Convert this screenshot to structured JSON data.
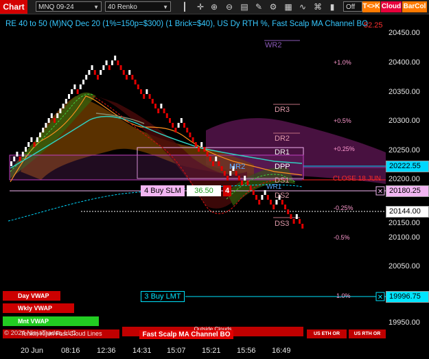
{
  "toolbar": {
    "title": "Chart",
    "instrument": "MNQ 09-24",
    "bar_type": "40 Renko",
    "toggle_value": "Off",
    "buttons": {
      "t_k": "T<>K",
      "cloud": "Cloud",
      "barcol": "BarCol"
    },
    "icons": [
      "bars-icon",
      "crosshair-icon",
      "zoom-in-icon",
      "zoom-out-icon",
      "data-box-icon",
      "pencil-icon",
      "chart-properties-icon",
      "templates-icon",
      "indicators-icon",
      "strategies-icon",
      "bar-style-icon",
      "camera-icon"
    ]
  },
  "chart_title": "RE 40 to 50 (M)NQ Dec 20 (1%=150p=$300) (1 Brick=$40), US Dy RTH %, Fast Scalp MA Channel BO",
  "overlay_partial": "52.25",
  "price_axis": {
    "ticks": [
      "20450.00",
      "20400.00",
      "20350.00",
      "20300.00",
      "20250.00",
      "20200.00",
      "20150.00",
      "20100.00",
      "20050.00",
      "19950.00"
    ],
    "boxes": [
      {
        "label": "20222.55",
        "color": "#00d8ff",
        "text": "#000000"
      },
      {
        "label": "20180.25",
        "color": "#f2b6f2",
        "text": "#000000"
      },
      {
        "label": "20144.00",
        "color": "#ffffff",
        "text": "#000000"
      },
      {
        "label": "19996.75",
        "color": "#00e5ff",
        "text": "#000000"
      }
    ]
  },
  "time_axis": [
    "20 Jun",
    "08:16",
    "12:36",
    "14:31",
    "15:07",
    "15:21",
    "15:56",
    "16:49"
  ],
  "levels": {
    "wr2": "WR2",
    "dr3": "DR3",
    "dr2": "DR2",
    "dr1": "DR1",
    "dpp": "DPP",
    "mr2": "MR2",
    "ds1": "DS1",
    "wr1": "WR1",
    "ds2": "DS2",
    "ds3": "DS3",
    "close_label": "CLOSE 18 JUN"
  },
  "percent_labels": [
    "+1.0%",
    "+0.5%",
    "+0.25%",
    "-0.25%",
    "-0.5%",
    "1.0%"
  ],
  "orders": {
    "buy_slm": {
      "label": "4 Buy SLM",
      "price": "36.50",
      "qty": "4"
    },
    "buy_lmt": {
      "label": "3 Buy LMT"
    }
  },
  "vwap_buttons": [
    "Day VWAP",
    "Wkly VWAP",
    "Mnt VWAP"
  ],
  "bottom_buttons": {
    "fast_scalp": "Fast Scalp MA Channel BO",
    "outside_clouds": "Outside Clouds",
    "us_eth": "US ETH OR",
    "us_rth": "US RTH OR"
  },
  "copyright": "© 2024 NinjaTrader, LLC",
  "indicator_label": "Tenkin Kijun Fast Cloud Lines",
  "colors": {
    "up_brick": "#ffffff",
    "down_brick": "#e00000",
    "accent_cyan": "#00d8ff",
    "magenta": "#d040d0",
    "orange": "#ff9020"
  }
}
